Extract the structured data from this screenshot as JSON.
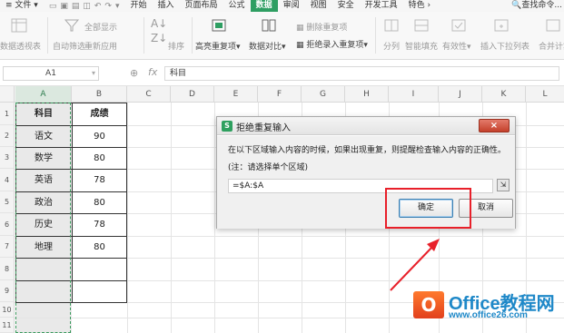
{
  "menubar": {
    "file_label": "文件",
    "items": [
      "开始",
      "插入",
      "页面布局",
      "公式",
      "数据",
      "审阅",
      "视图",
      "安全",
      "开发工具",
      "特色"
    ],
    "active_item": "数据",
    "search_label": "查找命令..."
  },
  "ribbon": {
    "pivot": "数据透视表",
    "autofilter": "自动筛选",
    "show_all": "全部显示",
    "reapply": "重新应用",
    "sort": "排序",
    "highlight_dup": "高亮重复项",
    "compare": "数据对比",
    "delete_dup": "删除重复项",
    "reject_dup": "拒绝录入重复项",
    "split": "分列",
    "smart_fill": "智能填充",
    "validity": "有效性",
    "insert_dropdown": "插入下拉列表",
    "merge_calc": "合并计算"
  },
  "formula_bar": {
    "cell_ref": "A1",
    "fx": "fx",
    "content": "科目"
  },
  "columns": [
    "A",
    "B",
    "C",
    "D",
    "E",
    "F",
    "G",
    "H",
    "I",
    "J",
    "K",
    "L"
  ],
  "rows": [
    "1",
    "2",
    "3",
    "4",
    "5",
    "6",
    "7",
    "8",
    "9",
    "10",
    "11"
  ],
  "table": {
    "headers": [
      "科目",
      "成绩"
    ],
    "rows": [
      [
        "语文",
        "90"
      ],
      [
        "数学",
        "80"
      ],
      [
        "英语",
        "78"
      ],
      [
        "政治",
        "80"
      ],
      [
        "历史",
        "78"
      ],
      [
        "地理",
        "80"
      ]
    ]
  },
  "dialog": {
    "title": "拒绝重复输入",
    "close_label": "×",
    "line1": "在以下区域输入内容的时候，如果出现重复，则提醒检查输入内容的正确性。",
    "line2": "(注：请选择单个区域)",
    "range_value": "=$A:$A",
    "ok_label": "确定",
    "cancel_label": "取消"
  },
  "watermark": {
    "logo_text": "O",
    "title": "Office教程网",
    "url": "www.office26.com"
  },
  "colors": {
    "accent_green": "#2e9e62",
    "highlight_red": "#e8202a",
    "watermark_blue": "#1e88c8"
  }
}
